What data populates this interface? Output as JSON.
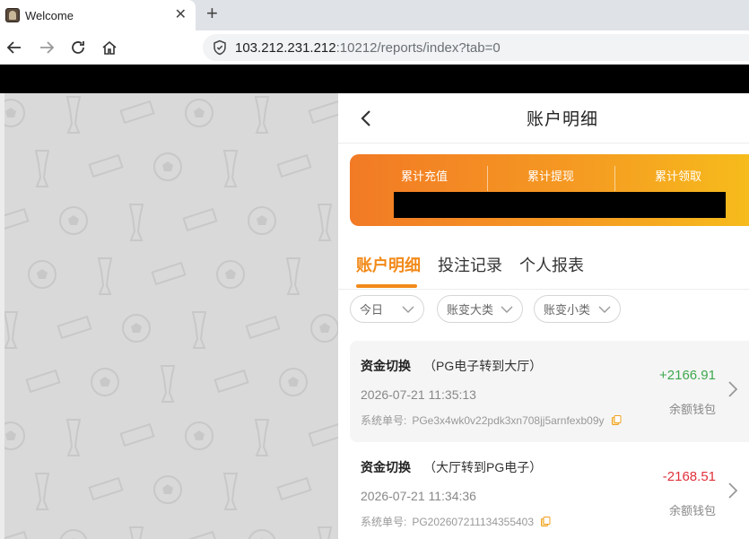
{
  "browser": {
    "tab_title": "Welcome",
    "tab_close": "✕",
    "new_tab": "+",
    "url_host": "103.212.231.212",
    "url_rest": ":10212/reports/index?tab=0"
  },
  "page": {
    "title": "账户明细"
  },
  "summary": {
    "labels": [
      "累计充值",
      "累计提现",
      "累计领取"
    ]
  },
  "tabs": [
    "账户明细",
    "投注记录",
    "个人报表"
  ],
  "active_tab_index": 0,
  "filters": [
    "今日",
    "账变大类",
    "账变小类"
  ],
  "records": [
    {
      "type": "资金切换",
      "detail": "（PG电子转到大厅）",
      "time": "2026-07-21 11:35:13",
      "order_label": "系统单号:",
      "order_no": "PGe3x4wk0v22pdk3xn708jj5arnfexb09y",
      "amount": "+2166.91",
      "wallet": "余额钱包"
    },
    {
      "type": "资金切换",
      "detail": "（大厅转到PG电子）",
      "time": "2026-07-21 11:34:36",
      "order_label": "系统单号:",
      "order_no": "PG202607211134355403",
      "amount": "-2168.51",
      "wallet": "余额钱包"
    }
  ],
  "colors": {
    "accent": "#f28a1a",
    "positive": "#3ea84e",
    "negative": "#e0303a",
    "gradient_start": "#f27a25",
    "gradient_end": "#f6be1b"
  },
  "icons": [
    "back-arrow-icon",
    "forward-arrow-icon",
    "reload-icon",
    "home-icon",
    "site-info-icon",
    "chevron-left-icon",
    "chevron-down-icon",
    "copy-icon",
    "chevron-right-icon"
  ]
}
